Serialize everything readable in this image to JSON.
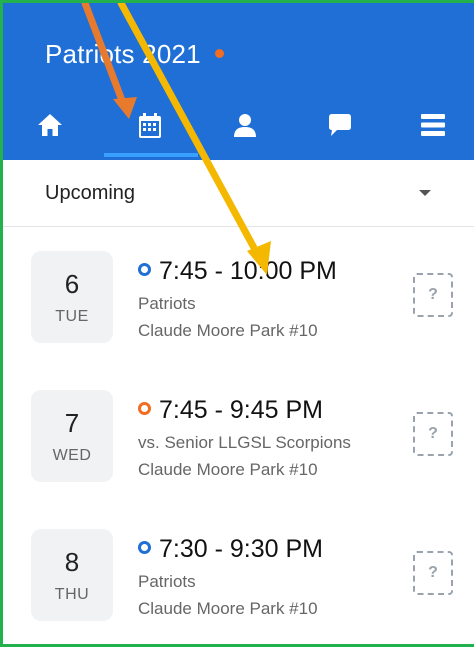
{
  "app": {
    "team_title": "Patriots 2021",
    "accent": "#1f6fd6",
    "status_color": "#f26d21"
  },
  "tabs": [
    {
      "name": "home",
      "icon": "home-icon"
    },
    {
      "name": "schedule",
      "icon": "calendar-icon",
      "active": true
    },
    {
      "name": "roster",
      "icon": "person-icon"
    },
    {
      "name": "chat",
      "icon": "chat-bubble-icon"
    },
    {
      "name": "menu",
      "icon": "hamburger-menu-icon"
    }
  ],
  "filter": {
    "label": "Upcoming"
  },
  "events": [
    {
      "date": "6",
      "day": "TUE",
      "time": "7:45 - 10:00 PM",
      "line1": "Patriots",
      "line2": "Claude Moore Park #10",
      "type": "practice",
      "rsvp": "?"
    },
    {
      "date": "7",
      "day": "WED",
      "time": "7:45 - 9:45 PM",
      "line1": "vs. Senior LLGSL Scorpions",
      "line2": "Claude Moore Park #10",
      "type": "game",
      "rsvp": "?"
    },
    {
      "date": "8",
      "day": "THU",
      "time": "7:30 - 9:30 PM",
      "line1": "Patriots",
      "line2": "Claude Moore Park #10",
      "type": "practice",
      "rsvp": "?"
    }
  ]
}
